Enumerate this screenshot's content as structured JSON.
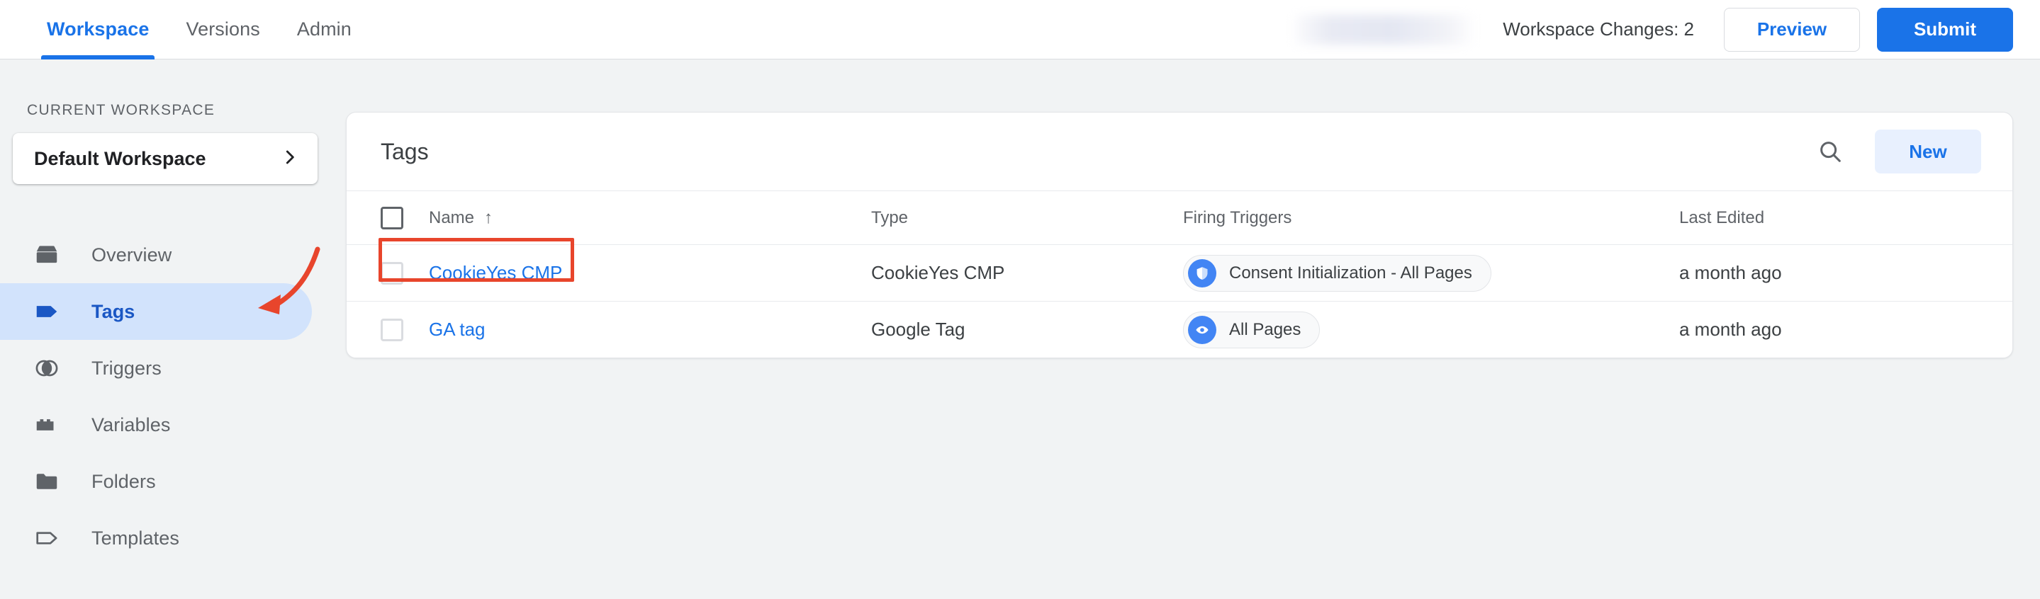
{
  "topbar": {
    "tabs": [
      {
        "label": "Workspace",
        "active": true
      },
      {
        "label": "Versions",
        "active": false
      },
      {
        "label": "Admin",
        "active": false
      }
    ],
    "account_redacted": "",
    "workspace_changes": "Workspace Changes: 2",
    "preview_label": "Preview",
    "submit_label": "Submit"
  },
  "sidebar": {
    "section_label": "CURRENT WORKSPACE",
    "workspace_name": "Default Workspace",
    "items": [
      {
        "label": "Overview",
        "icon": "overview-box-icon",
        "active": false
      },
      {
        "label": "Tags",
        "icon": "tag-filled-icon",
        "active": true
      },
      {
        "label": "Triggers",
        "icon": "triggers-circles-icon",
        "active": false
      },
      {
        "label": "Variables",
        "icon": "variables-brick-icon",
        "active": false
      },
      {
        "label": "Folders",
        "icon": "folder-icon",
        "active": false
      },
      {
        "label": "Templates",
        "icon": "tag-outline-icon",
        "active": false
      }
    ]
  },
  "main": {
    "card_title": "Tags",
    "search_icon": "search-icon",
    "new_label": "New",
    "columns": {
      "name": "Name",
      "sort_indicator": "↑",
      "type": "Type",
      "firing_triggers": "Firing Triggers",
      "last_edited": "Last Edited"
    },
    "rows": [
      {
        "name": "CookieYes CMP",
        "type": "CookieYes CMP",
        "trigger": {
          "label": "Consent Initialization - All Pages",
          "icon": "shield-icon"
        },
        "last_edited": "a month ago",
        "highlighted": true
      },
      {
        "name": "GA tag",
        "type": "Google Tag",
        "trigger": {
          "label": "All Pages",
          "icon": "eye-icon"
        },
        "last_edited": "a month ago",
        "highlighted": false
      }
    ]
  },
  "annotations": {
    "highlight_color": "#e8452c",
    "arrow_color": "#e8452c",
    "highlight_target": "CookieYes CMP",
    "arrow_target": "Tags"
  },
  "colors": {
    "accent_blue": "#1a73e8",
    "active_nav_bg": "#d2e3fc",
    "page_bg": "#f1f3f4",
    "chip_icon_blue": "#4285f4"
  }
}
